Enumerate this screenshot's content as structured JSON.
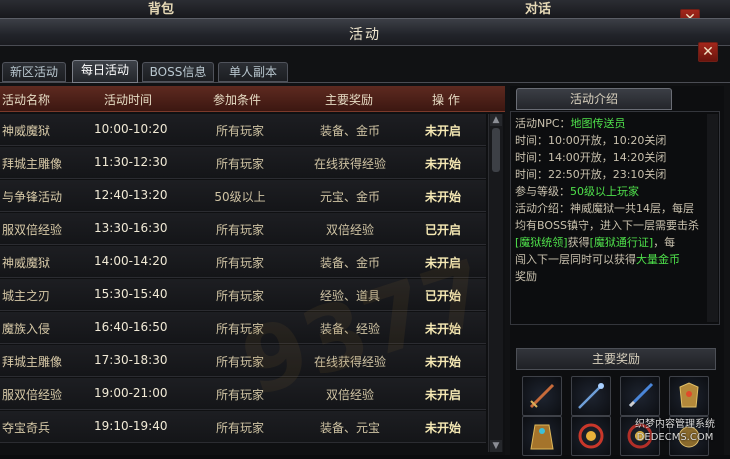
{
  "background_window": {
    "title_left": "背包",
    "title_right": "对话",
    "close_label": "✕"
  },
  "window": {
    "title": "活动",
    "close_label": "✕"
  },
  "tabs": [
    {
      "label": "新区活动",
      "active": false
    },
    {
      "label": "每日活动",
      "active": true
    },
    {
      "label": "BOSS信息",
      "active": false
    },
    {
      "label": "单人副本",
      "active": false
    }
  ],
  "table": {
    "headers": [
      "活动名称",
      "活动时间",
      "参加条件",
      "主要奖励",
      "操  作"
    ],
    "rows": [
      {
        "name": "神威魔狱",
        "time": "10:00-10:20",
        "condition": "所有玩家",
        "reward": "装备、金币",
        "action": "未开启"
      },
      {
        "name": "拜城主雕像",
        "time": "11:30-12:30",
        "condition": "所有玩家",
        "reward": "在线获得经验",
        "action": "未开始"
      },
      {
        "name": "与争锋活动",
        "time": "12:40-13:20",
        "condition": "50级以上",
        "reward": "元宝、金币",
        "action": "未开始"
      },
      {
        "name": "服双倍经验",
        "time": "13:30-16:30",
        "condition": "所有玩家",
        "reward": "双倍经验",
        "action": "已开启"
      },
      {
        "name": "神威魔狱",
        "time": "14:00-14:20",
        "condition": "所有玩家",
        "reward": "装备、金币",
        "action": "未开启"
      },
      {
        "name": "城主之刃",
        "time": "15:30-15:40",
        "condition": "所有玩家",
        "reward": "经验、道具",
        "action": "已开始"
      },
      {
        "name": "魔族入侵",
        "time": "16:40-16:50",
        "condition": "所有玩家",
        "reward": "装备、经验",
        "action": "未开始"
      },
      {
        "name": "拜城主雕像",
        "time": "17:30-18:30",
        "condition": "所有玩家",
        "reward": "在线获得经验",
        "action": "未开始"
      },
      {
        "name": "服双倍经验",
        "time": "19:00-21:00",
        "condition": "所有玩家",
        "reward": "双倍经验",
        "action": "未开启"
      },
      {
        "name": "夺宝奇兵",
        "time": "19:10-19:40",
        "condition": "所有玩家",
        "reward": "装备、元宝",
        "action": "未开始"
      }
    ]
  },
  "watermark": "9377",
  "info": {
    "tab_label": "活动介绍",
    "npc_label": "活动NPC：",
    "npc_value": "地图传送员",
    "times": [
      "时间：10:00开放，10:20关闭",
      "时间：14:00开放，14:20关闭",
      "时间：22:50开放，23:10关闭"
    ],
    "level_label": "参与等级：",
    "level_value": "50级以上玩家",
    "desc_1": "活动介绍：神威魔狱一共14层，每层",
    "desc_2": "均有BOSS镇守，进入下一层需要击杀",
    "desc_3a": "[魔狱统领]",
    "desc_3b": "获得",
    "desc_3c": "[魔狱通行证]",
    "desc_3d": "，每",
    "desc_4a": "闯入下一层同时可以获得",
    "desc_4b": "大量金币",
    "desc_5": "奖励"
  },
  "rewards": {
    "header": "主要奖励",
    "items": [
      "sword-icon",
      "staff-icon",
      "blade-icon",
      "armor-icon",
      "robe-icon",
      "ring-icon",
      "ring-icon",
      "medal-icon"
    ]
  },
  "site_watermark": {
    "line1": "织梦内容管理系统",
    "line2": "DEDECMS.COM"
  },
  "colors": {
    "header_red": "#5e2a20",
    "green_text": "#4fe14b",
    "yellow_text": "#e8d54a"
  }
}
